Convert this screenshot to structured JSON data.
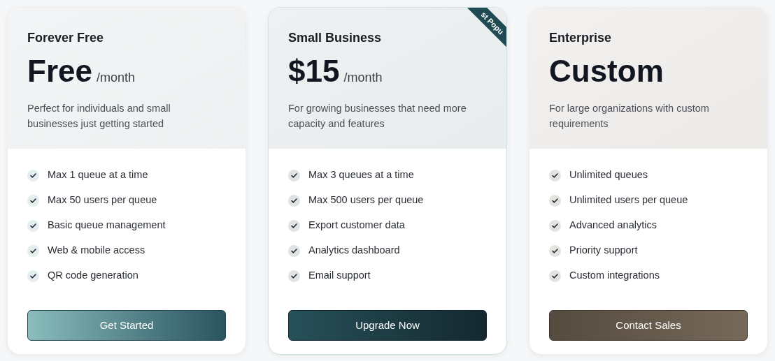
{
  "plans": [
    {
      "kind": "free",
      "featured": false,
      "name": "Forever Free",
      "price": "Free",
      "period": "/month",
      "description": "Perfect for individuals and small businesses just getting started",
      "features": [
        "Max 1 queue at a time",
        "Max 50 users per queue",
        "Basic queue management",
        "Web & mobile access",
        "QR code generation"
      ],
      "button": "Get Started"
    },
    {
      "kind": "business",
      "featured": true,
      "ribbon": "st Popu",
      "name": "Small Business",
      "price": "$15",
      "period": "/month",
      "description": "For growing businesses that need more capacity and features",
      "features": [
        "Max 3 queues at a time",
        "Max 500 users per queue",
        "Export customer data",
        "Analytics dashboard",
        "Email support"
      ],
      "button": "Upgrade Now"
    },
    {
      "kind": "enterprise",
      "featured": false,
      "name": "Enterprise",
      "price": "Custom",
      "description": "For large organizations with custom requirements",
      "features": [
        "Unlimited queues",
        "Unlimited users per queue",
        "Advanced analytics",
        "Priority support",
        "Custom integrations"
      ],
      "button": "Contact Sales"
    }
  ]
}
